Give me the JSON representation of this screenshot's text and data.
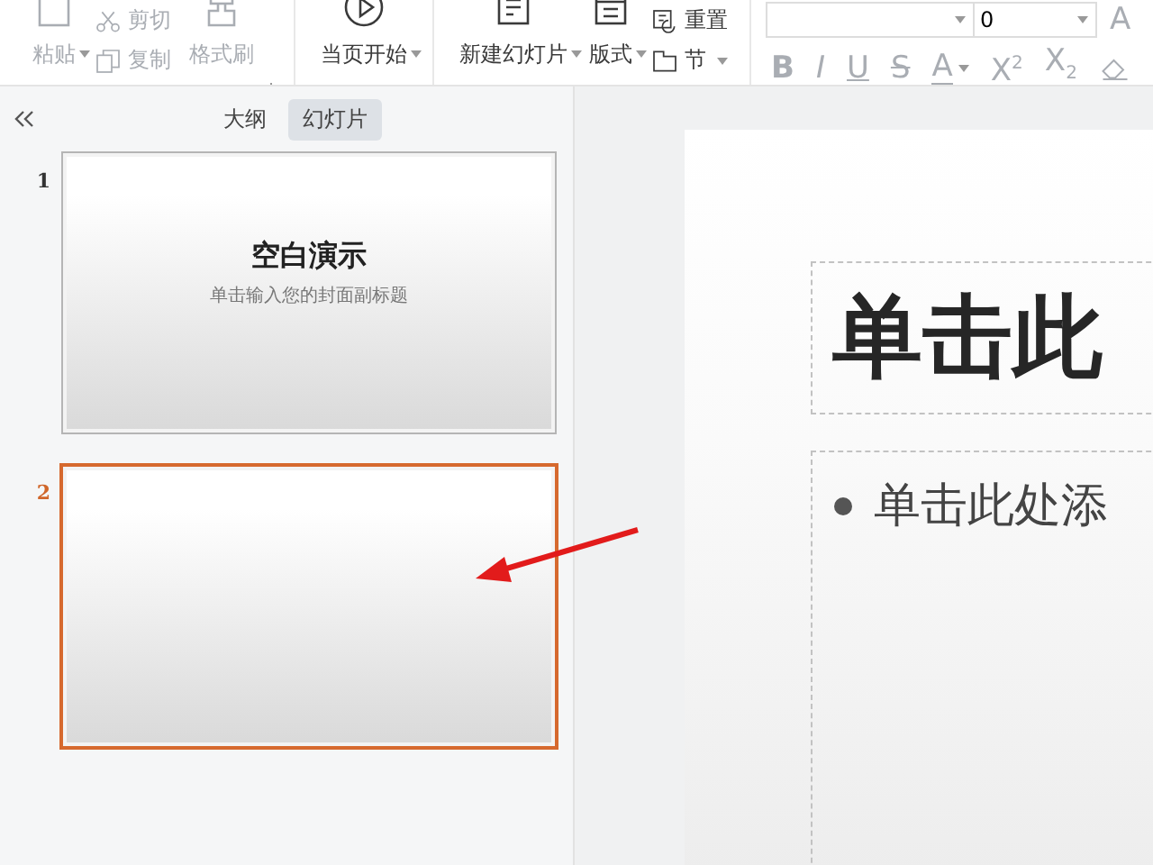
{
  "toolbar": {
    "items": [
      {
        "kind": "large",
        "label": "粘贴",
        "dropdown": true,
        "disabled": true
      },
      {
        "kind": "stack",
        "entries": [
          {
            "label": "剪切",
            "disabled": true
          },
          {
            "label": "复制",
            "disabled": true
          }
        ]
      },
      {
        "kind": "large",
        "label": "格式刷",
        "dropdown": false,
        "disabled": true
      },
      {
        "kind": "separator"
      },
      {
        "kind": "large",
        "label": "当页开始",
        "dropdown": true,
        "disabled": false
      },
      {
        "kind": "separator"
      },
      {
        "kind": "large",
        "label": "新建幻灯片",
        "dropdown": true,
        "disabled": false
      },
      {
        "kind": "large",
        "label": "版式",
        "dropdown": true,
        "disabled": false
      },
      {
        "kind": "stack",
        "entries": [
          {
            "label": "重置",
            "disabled": false
          },
          {
            "label": "节",
            "dropdown": true,
            "disabled": false
          }
        ]
      },
      {
        "kind": "separator"
      },
      {
        "kind": "font"
      }
    ],
    "font_size": {
      "value": "0"
    },
    "grow_font": {
      "label": "A",
      "disabled": true
    },
    "format_buttons": [
      {
        "label": "B",
        "disabled": true
      },
      {
        "label": "I",
        "disabled": true
      },
      {
        "label": "U",
        "disabled": true
      },
      {
        "label": "S",
        "disabled": true
      },
      {
        "label": "A",
        "dropdown": true,
        "disabled": true
      },
      {
        "label": "X$^{2}$",
        "disabled": true
      },
      {
        "label": "X$_{2}$",
        "disabled": true
      },
      {
        "kind": "eraser",
        "disabled": true
      }
    ]
  },
  "panel": {
    "tabs": [
      {
        "label": "大纲",
        "selected": false
      },
      {
        "label": "幻灯片",
        "selected": true
      }
    ],
    "slides": [
      {
        "number": "1",
        "selected": false,
        "title": "空白演示",
        "subtitle": "单击输入您的封面副标题"
      },
      {
        "number": "2",
        "selected": true
      }
    ]
  },
  "editor": {
    "title_placeholder": "单击此",
    "body_placeholder": "单击此处添"
  }
}
